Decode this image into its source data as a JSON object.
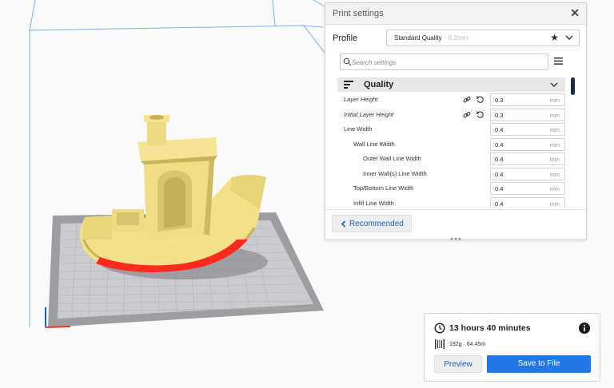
{
  "viewport": {
    "colors": {
      "model": "#f3e08a",
      "model_shade": "#c9b35a",
      "overhang": "#ff2a1e",
      "build_plate": "#9c9ea2",
      "grid": "#c5c7cb",
      "volume_lines": "#7aaef0"
    }
  },
  "print_settings": {
    "title": "Print settings",
    "close_icon": "close-icon",
    "profile": {
      "label": "Profile",
      "name": "Standard Quality",
      "layer": "- 0.2mm",
      "favorite_icon": "star-icon",
      "dropdown_icon": "chevron-down-icon"
    },
    "search": {
      "placeholder": "Search settings",
      "value": ""
    },
    "category": {
      "label": "Quality",
      "icon": "quality-icon"
    },
    "settings": [
      {
        "label": "Layer Height",
        "value": "0.3",
        "unit": "mm",
        "italic": true,
        "linked": true
      },
      {
        "label": "Initial Layer Height",
        "value": "0.3",
        "unit": "mm",
        "italic": true,
        "linked": true
      },
      {
        "label": "Line Width",
        "value": "0.4",
        "unit": "mm",
        "indent": 0
      },
      {
        "label": "Wall Line Width",
        "value": "0.4",
        "unit": "mm",
        "indent": 1
      },
      {
        "label": "Outer Wall Line Width",
        "value": "0.4",
        "unit": "mm",
        "indent": 2
      },
      {
        "label": "Inner Wall(s) Line Width",
        "value": "0.4",
        "unit": "mm",
        "indent": 2
      },
      {
        "label": "Top/Bottom Line Width",
        "value": "0.4",
        "unit": "mm",
        "indent": 1
      },
      {
        "label": "Infill Line Width",
        "value": "0.4",
        "unit": "mm",
        "indent": 1
      }
    ],
    "recommended_label": "Recommended"
  },
  "action_panel": {
    "time": "13 hours 40 minutes",
    "material": "192g · 64.45m",
    "preview_label": "Preview",
    "save_label": "Save to File",
    "colors": {
      "primary": "#2176e8",
      "link": "#1d5eb4"
    }
  }
}
